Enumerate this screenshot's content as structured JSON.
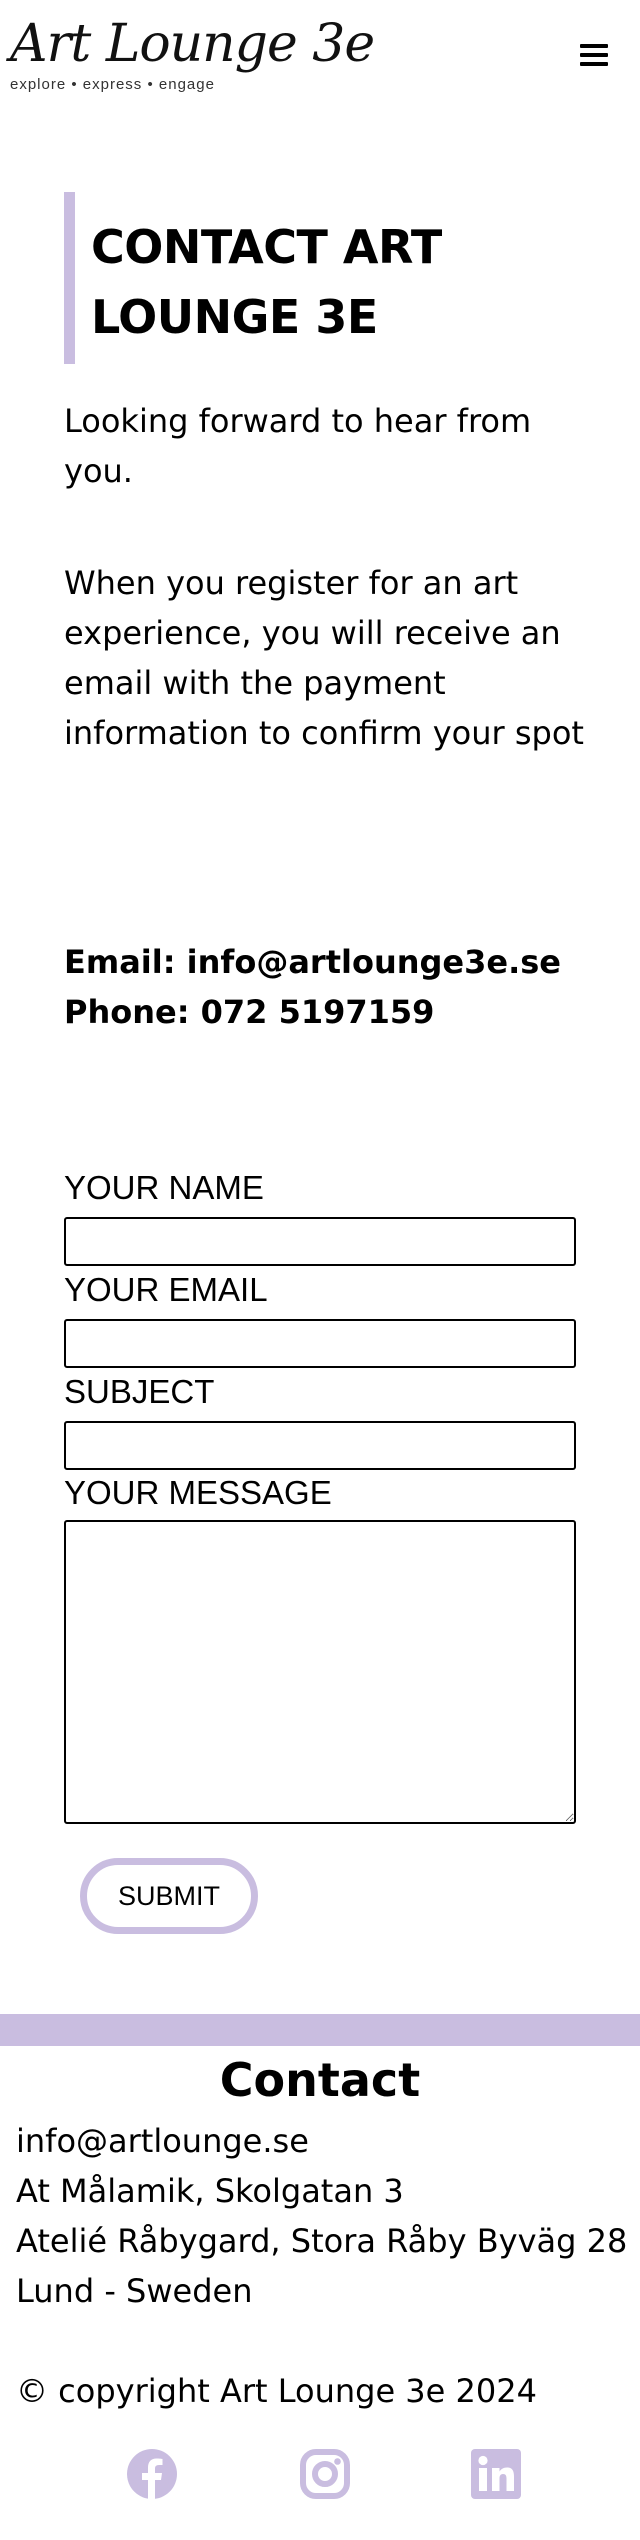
{
  "header": {
    "logo_text": "Art Lounge 3e",
    "logo_tagline": "explore • express • engage",
    "menu_icon": "hamburger-menu-icon"
  },
  "main": {
    "title": "CONTACT ART LOUNGE 3E",
    "intro": "Looking forward to hear from you.",
    "payment_note": "When you register for an art experience, you will receive an email with the payment information to confirm your spot",
    "email_line": "Email: info@artlounge3e.se",
    "phone_line": "Phone: 072 5197159"
  },
  "form": {
    "name_label": "YOUR NAME",
    "name_value": "",
    "email_label": "YOUR EMAIL",
    "email_value": "",
    "subject_label": "SUBJECT",
    "subject_value": "",
    "message_label": "YOUR MESSAGE",
    "message_value": "",
    "submit_label": "SUBMIT"
  },
  "footer": {
    "title": "Contact",
    "email": "info@artlounge.se",
    "address_1": "At Målamik, Skolgatan 3",
    "address_2": "Atelié Råbygard, Stora Råby Byväg 28",
    "address_3": "Lund - Sweden",
    "copyright": "© copyright Art Lounge 3e 2024",
    "social_icons": [
      "facebook-icon",
      "instagram-icon",
      "linkedin-icon"
    ]
  },
  "colors": {
    "accent": "#c9bde0",
    "text": "#000000",
    "background": "#ffffff"
  }
}
